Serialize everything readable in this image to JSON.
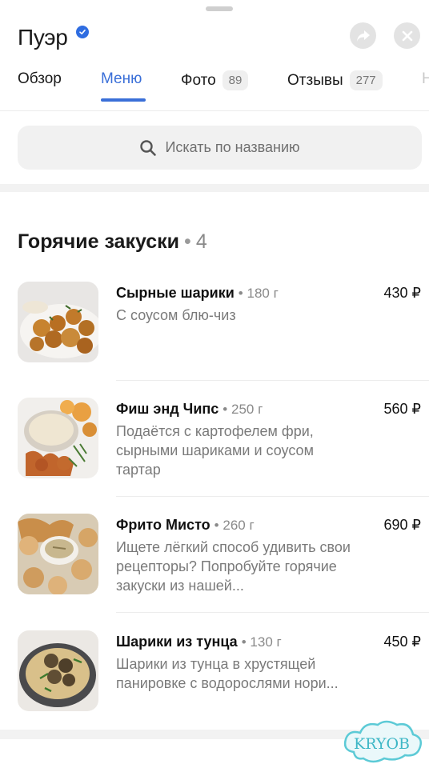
{
  "header": {
    "title": "Пуэр"
  },
  "tabs": [
    {
      "label": "Обзор",
      "count": null
    },
    {
      "label": "Меню",
      "count": null
    },
    {
      "label": "Фото",
      "count": "89"
    },
    {
      "label": "Отзывы",
      "count": "277"
    },
    {
      "label": "Н",
      "count": null
    }
  ],
  "search": {
    "placeholder": "Искать по названию"
  },
  "section": {
    "title": "Горячие закуски",
    "count": "4"
  },
  "items": [
    {
      "name": "Сырные шарики",
      "weight": "180 г",
      "desc": "С соусом блю-чиз",
      "price": "430 ₽"
    },
    {
      "name": "Фиш энд Чипс",
      "weight": "250 г",
      "desc": "Подаётся с картофелем фри, сырными шариками и соусом тартар",
      "price": "560 ₽"
    },
    {
      "name": "Фрито Мисто",
      "weight": "260 г",
      "desc": "Ищете лёгкий способ удивить свои рецепторы? Попробуйте горячие закуски из нашей...",
      "price": "690 ₽"
    },
    {
      "name": "Шарики из тунца",
      "weight": "130 г",
      "desc": "Шарики из тунца в хрустящей панировке с водорослями нори...",
      "price": "450 ₽"
    }
  ],
  "watermark": {
    "text": "KRYOB"
  },
  "colors": {
    "accent": "#3a6fd8",
    "verified": "#2f6de1"
  }
}
